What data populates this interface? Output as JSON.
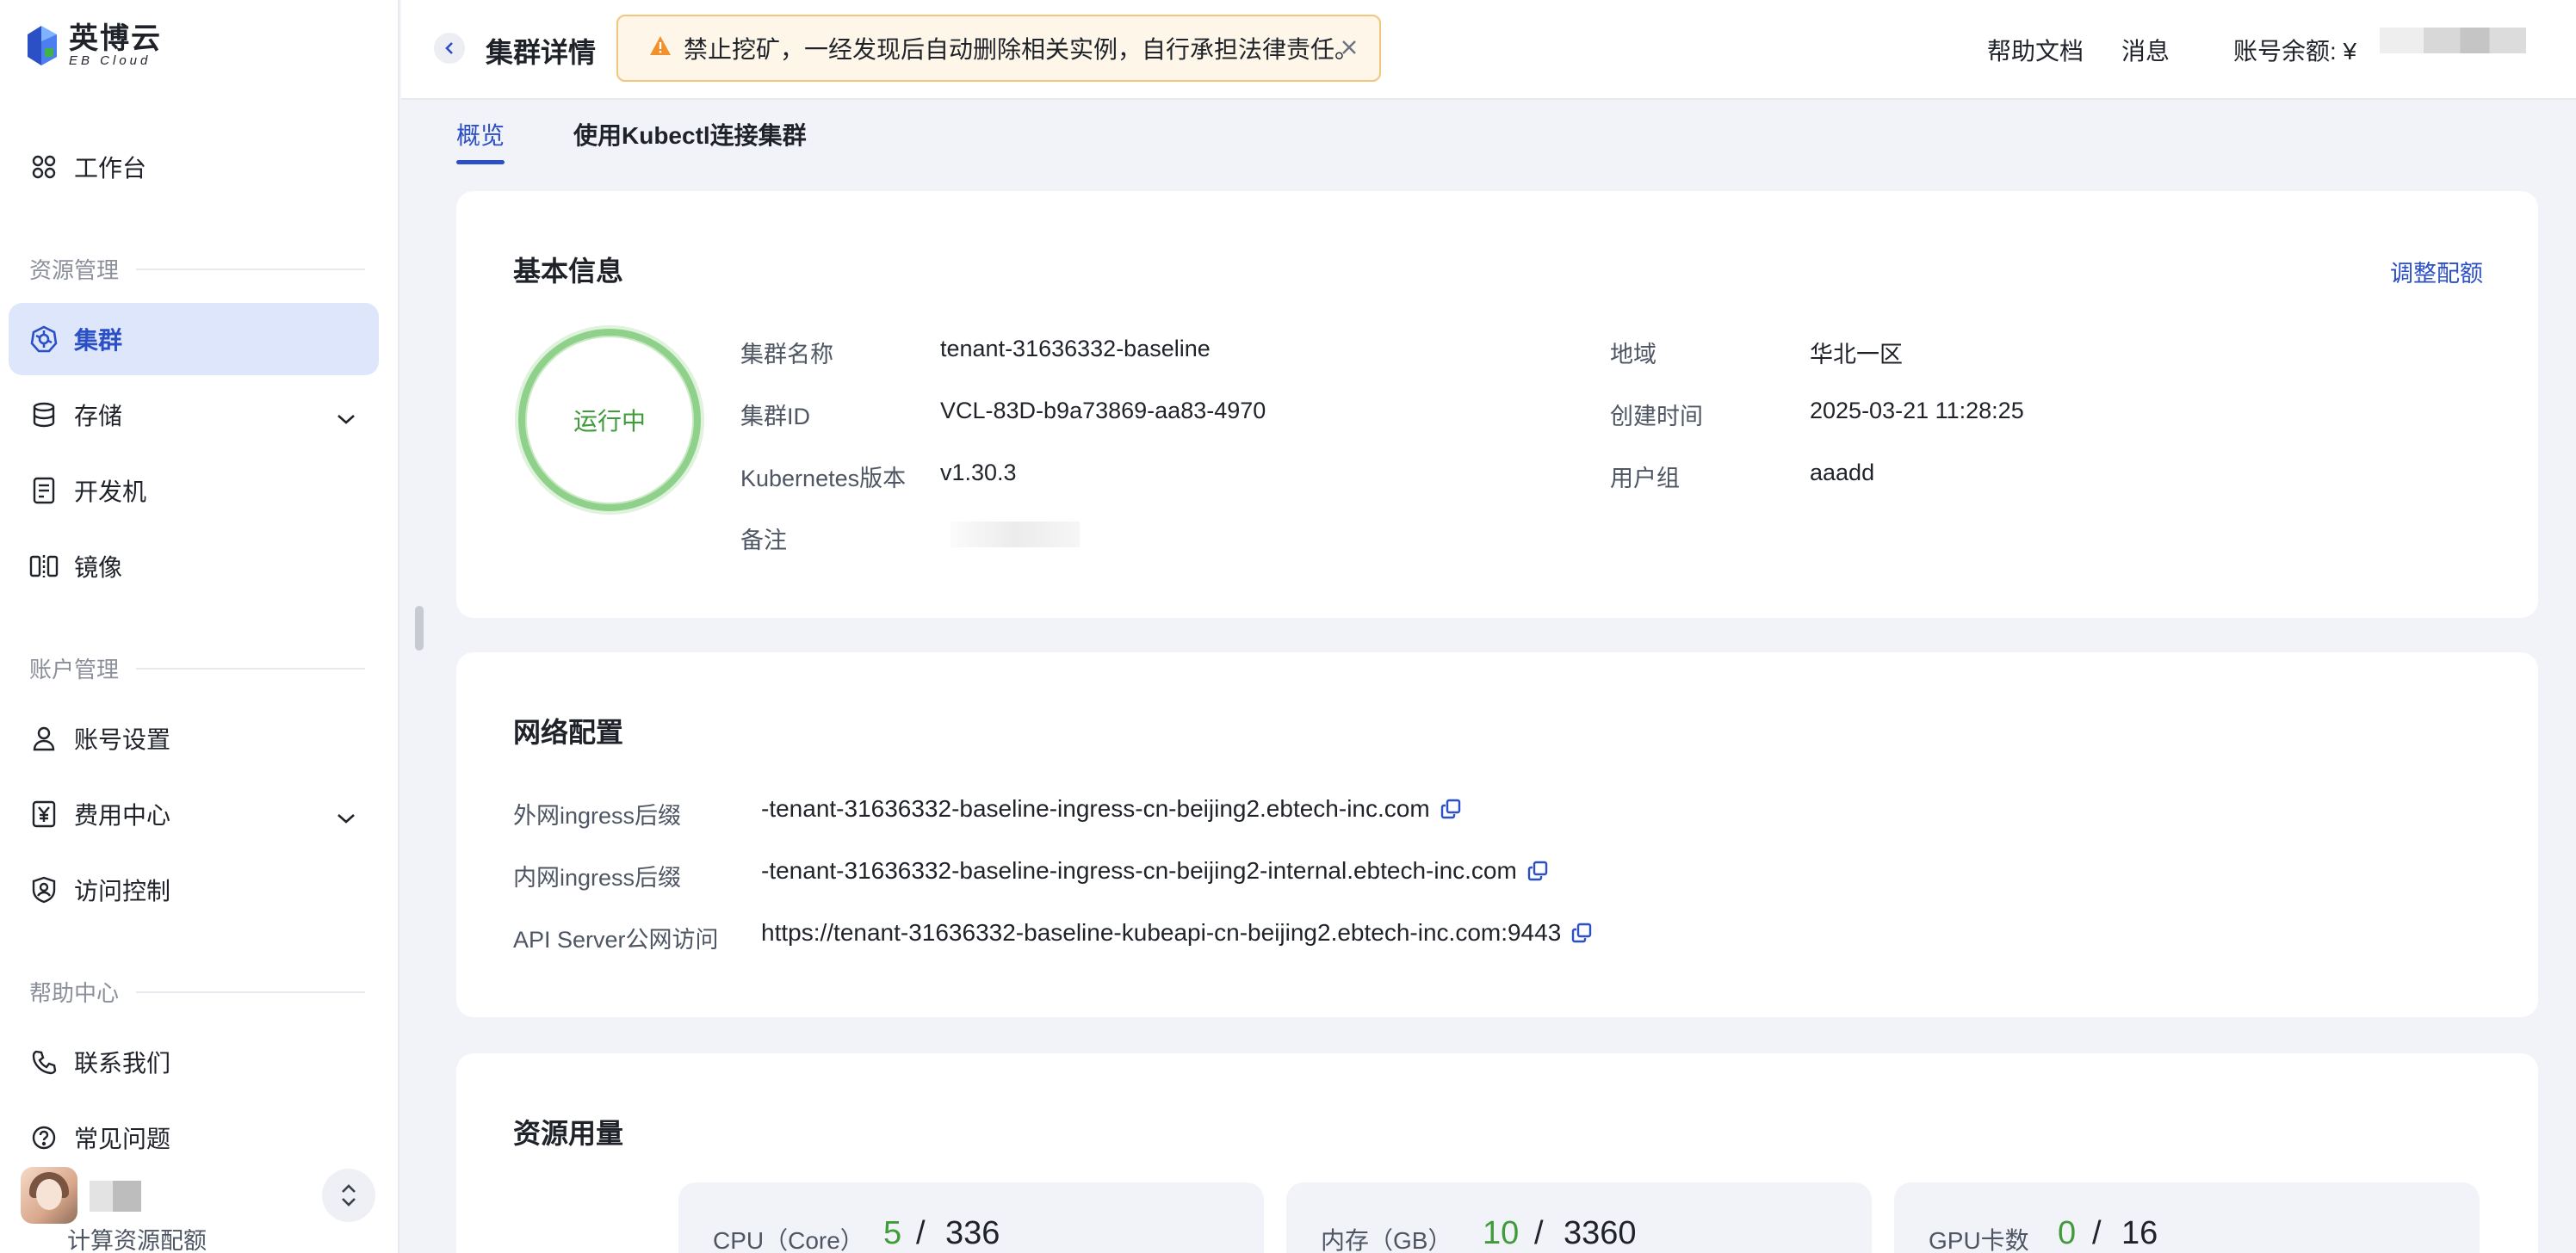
{
  "brand": {
    "name_cn": "英博云",
    "name_en": "EB Cloud"
  },
  "sidebar": {
    "workbench": "工作台",
    "sections": {
      "resource": "资源管理",
      "account": "账户管理",
      "help": "帮助中心"
    },
    "items": [
      {
        "label": "集群",
        "icon": "cluster-icon",
        "active": true
      },
      {
        "label": "存储",
        "icon": "storage-icon",
        "expandable": true
      },
      {
        "label": "开发机",
        "icon": "devbox-icon"
      },
      {
        "label": "镜像",
        "icon": "image-icon"
      },
      {
        "label": "账号设置",
        "icon": "user-icon"
      },
      {
        "label": "费用中心",
        "icon": "yen-icon",
        "expandable": true
      },
      {
        "label": "访问控制",
        "icon": "shield-user-icon"
      },
      {
        "label": "联系我们",
        "icon": "phone-icon"
      },
      {
        "label": "常见问题",
        "icon": "question-icon"
      }
    ]
  },
  "header": {
    "title": "集群详情",
    "warning": "禁止挖矿，一经发现后自动删除相关实例，自行承担法律责任。",
    "help_docs": "帮助文档",
    "messages": "消息",
    "balance_label": "账号余额: ¥"
  },
  "tabs": [
    {
      "label": "概览",
      "active": true
    },
    {
      "label": "使用Kubectl连接集群",
      "active": false
    }
  ],
  "basic_info": {
    "title": "基本信息",
    "adjust_quota": "调整配额",
    "status": "运行中",
    "fields": {
      "name_label": "集群名称",
      "name_value": "tenant-31636332-baseline",
      "id_label": "集群ID",
      "id_value": "VCL-83D-b9a73869-aa83-4970",
      "k8s_label": "Kubernetes版本",
      "k8s_value": "v1.30.3",
      "note_label": "备注",
      "region_label": "地域",
      "region_value": "华北一区",
      "created_label": "创建时间",
      "created_value": "2025-03-21 11:28:25",
      "group_label": "用户组",
      "group_value": "aaadd"
    }
  },
  "network": {
    "title": "网络配置",
    "rows": [
      {
        "label": "外网ingress后缀",
        "value": "-tenant-31636332-baseline-ingress-cn-beijing2.ebtech-inc.com"
      },
      {
        "label": "内网ingress后缀",
        "value": "-tenant-31636332-baseline-ingress-cn-beijing2-internal.ebtech-inc.com"
      },
      {
        "label": "API Server公网访问",
        "value": "https://tenant-31636332-baseline-kubeapi-cn-beijing2.ebtech-inc.com:9443"
      }
    ]
  },
  "resources": {
    "title": "资源用量",
    "quota_label": "计算资源配额",
    "items": [
      {
        "name": "CPU（Core）",
        "used": "5",
        "sep": "/",
        "total": "336"
      },
      {
        "name": "内存（GB）",
        "used": "10",
        "sep": "/",
        "total": "3360"
      },
      {
        "name": "GPU卡数",
        "used": "0",
        "sep": "/",
        "total": "16"
      }
    ]
  },
  "colors": {
    "accent": "#2b4fc4",
    "active_bg": "#dde6fa",
    "success": "#3f9c3a",
    "warning_border": "#f0c77a"
  }
}
